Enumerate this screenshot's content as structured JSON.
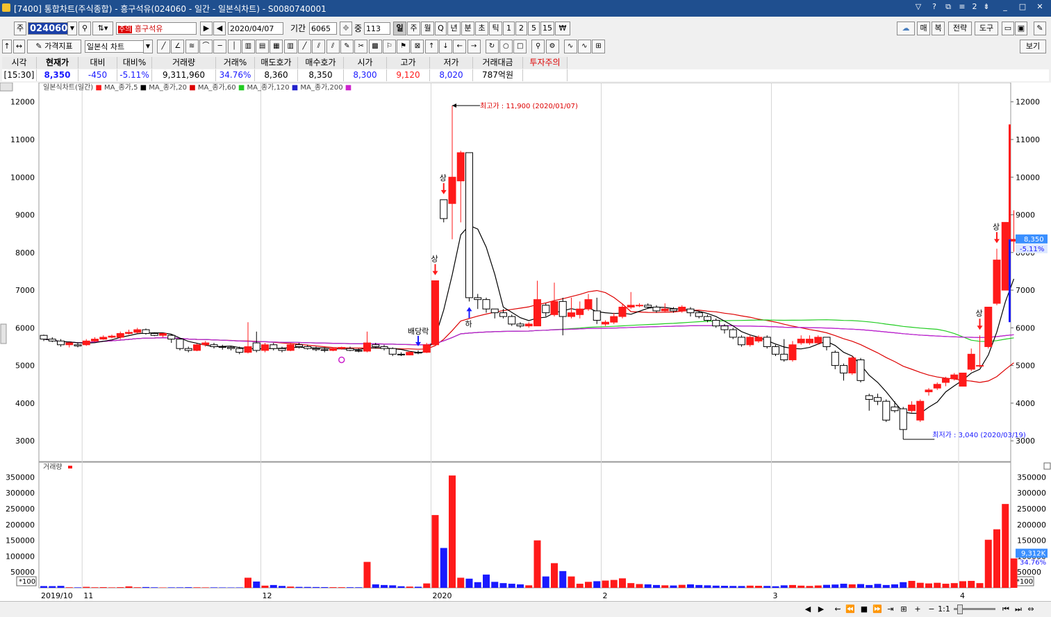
{
  "window": {
    "title": "[7400] 통합차트(주식종합) - 흥구석유(024060 - 일간 - 일본식차트) - S0080740001"
  },
  "toolbar1": {
    "jong_label": "주",
    "code": "024060",
    "warn_badge": "주의",
    "stock_name": "흥구석유",
    "date": "2020/04/07",
    "period_label": "기간",
    "period_value": "6065",
    "count_label": "중",
    "count_value": "113",
    "periods": [
      "일",
      "주",
      "월",
      "Q",
      "년",
      "분",
      "초",
      "틱",
      "1",
      "2",
      "5",
      "15",
      "₩"
    ],
    "right_buttons": [
      "매",
      "복",
      "전략",
      "도구"
    ]
  },
  "toolbar2": {
    "price_indicator": "가격지표",
    "chart_type": "일본식 차트",
    "view_button": "보기"
  },
  "quote": {
    "headers": [
      "시각",
      "현재가",
      "대비",
      "대비%",
      "거래량",
      "거래%",
      "매도호가",
      "매수호가",
      "시가",
      "고가",
      "저가",
      "거래대금",
      "투자주의"
    ],
    "values": [
      "[15:30]",
      "8,350",
      "-450",
      "-5.11%",
      "9,311,960",
      "34.76%",
      "8,360",
      "8,350",
      "8,300",
      "9,120",
      "8,020",
      "787억원",
      ""
    ]
  },
  "colors": {
    "up": "#ff1a1a",
    "down": "#1a1aff",
    "ma5": "#000000",
    "ma20": "#dd0000",
    "ma60": "#22cc22",
    "ma120": "#2222cc",
    "ma200": "#cc22cc"
  },
  "chart_data": {
    "type": "candlestick",
    "title": "일본식차트(일간)",
    "legend": [
      "MA_종가,5",
      "MA_종가,20",
      "MA_종가,60",
      "MA_종가,120",
      "MA_종가,200"
    ],
    "price_axis": {
      "ticks": [
        3000,
        4000,
        5000,
        6000,
        7000,
        8000,
        9000,
        10000,
        11000,
        12000
      ],
      "range": [
        2450,
        12400
      ]
    },
    "x_labels": [
      {
        "label": "2019/10",
        "index": 0
      },
      {
        "label": "11",
        "index": 5
      },
      {
        "label": "12",
        "index": 26
      },
      {
        "label": "2020",
        "index": 46
      },
      {
        "label": "2",
        "index": 66
      },
      {
        "label": "3",
        "index": 86
      },
      {
        "label": "4",
        "index": 108
      }
    ],
    "candles": [
      [
        5800,
        5700,
        5820,
        5650,
        5600
      ],
      [
        5700,
        5650,
        5750,
        5620,
        5400
      ],
      [
        5650,
        5550,
        5700,
        5500,
        6200
      ],
      [
        5550,
        5600,
        5620,
        5480,
        1800
      ],
      [
        5550,
        5520,
        5600,
        5480,
        1500
      ],
      [
        5550,
        5650,
        5700,
        5520,
        3100
      ],
      [
        5650,
        5700,
        5750,
        5620,
        1800
      ],
      [
        5700,
        5750,
        5800,
        5680,
        2200
      ],
      [
        5750,
        5780,
        5820,
        5720,
        1500
      ],
      [
        5750,
        5850,
        5900,
        5700,
        2100
      ],
      [
        5850,
        5880,
        5950,
        5820,
        4600
      ],
      [
        5880,
        5950,
        6000,
        5850,
        1900
      ],
      [
        5950,
        5850,
        5980,
        5820,
        2500
      ],
      [
        5850,
        5800,
        5880,
        5780,
        1700
      ],
      [
        5800,
        5850,
        5860,
        5750,
        1200
      ],
      [
        5800,
        5700,
        5820,
        5600,
        1500
      ],
      [
        5700,
        5450,
        5720,
        5400,
        1600
      ],
      [
        5450,
        5400,
        5500,
        5350,
        2000
      ],
      [
        5400,
        5550,
        5580,
        5380,
        1700
      ],
      [
        5550,
        5600,
        5650,
        5500,
        1400
      ],
      [
        5550,
        5500,
        5600,
        5450,
        1500
      ],
      [
        5500,
        5480,
        5550,
        5420,
        1300
      ],
      [
        5480,
        5450,
        5520,
        5400,
        1200
      ],
      [
        5450,
        5350,
        5500,
        5300,
        1300
      ],
      [
        5350,
        5500,
        6150,
        5320,
        32000
      ],
      [
        5600,
        5400,
        5900,
        5350,
        20000
      ],
      [
        5400,
        5550,
        5600,
        5350,
        7000
      ],
      [
        5550,
        5450,
        5600,
        5400,
        9000
      ],
      [
        5450,
        5400,
        5500,
        5350,
        6000
      ],
      [
        5400,
        5550,
        5600,
        5380,
        4000
      ],
      [
        5550,
        5500,
        5600,
        5450,
        3000
      ],
      [
        5500,
        5450,
        5550,
        5420,
        2800
      ],
      [
        5450,
        5420,
        5500,
        5380,
        2500
      ],
      [
        5420,
        5400,
        5480,
        5350,
        2300
      ],
      [
        5400,
        5450,
        5480,
        5380,
        2100
      ],
      [
        5450,
        5480,
        5500,
        5420,
        2000
      ],
      [
        5450,
        5400,
        5500,
        5380,
        1900
      ],
      [
        5400,
        5380,
        5450,
        5350,
        1800
      ],
      [
        5380,
        5600,
        5900,
        5350,
        82000
      ],
      [
        5550,
        5500,
        5600,
        5450,
        11000
      ],
      [
        5500,
        5450,
        5550,
        5400,
        9000
      ],
      [
        5450,
        5300,
        5480,
        5250,
        8000
      ],
      [
        5300,
        5280,
        5350,
        5250,
        5000
      ],
      [
        5280,
        5350,
        5380,
        5270,
        4000
      ],
      [
        5350,
        5330,
        5400,
        5300,
        3500
      ],
      [
        5350,
        5550,
        5600,
        5330,
        14000
      ],
      [
        5550,
        7250,
        7250,
        5550,
        230000
      ],
      [
        9400,
        8900,
        9400,
        8800,
        126000
      ],
      [
        9300,
        10000,
        11900,
        8350,
        355000
      ],
      [
        9900,
        10650,
        10700,
        8800,
        32000
      ],
      [
        10650,
        6800,
        7200,
        6700,
        29000
      ],
      [
        6800,
        6750,
        6900,
        6500,
        18000
      ],
      [
        6750,
        6500,
        6800,
        6400,
        42000
      ],
      [
        6500,
        6400,
        6500,
        6250,
        19000
      ],
      [
        6400,
        6300,
        6500,
        6250,
        15000
      ],
      [
        6300,
        6100,
        6350,
        6050,
        13000
      ],
      [
        6100,
        6050,
        6150,
        6000,
        11000
      ],
      [
        6050,
        6100,
        6150,
        6000,
        8000
      ],
      [
        6050,
        6750,
        7250,
        6050,
        150000
      ],
      [
        6600,
        6400,
        6650,
        6300,
        36000
      ],
      [
        6350,
        6700,
        7200,
        6300,
        78000
      ],
      [
        6700,
        6300,
        6800,
        5800,
        53000
      ],
      [
        6300,
        6400,
        6800,
        6250,
        36000
      ],
      [
        6350,
        6500,
        6700,
        6250,
        13000
      ],
      [
        6500,
        6750,
        6900,
        6450,
        19000
      ],
      [
        6450,
        6200,
        6800,
        6100,
        21000
      ],
      [
        6100,
        6150,
        6200,
        6050,
        23000
      ],
      [
        6150,
        6300,
        6400,
        6100,
        25000
      ],
      [
        6300,
        6550,
        6650,
        6250,
        30000
      ],
      [
        6550,
        6600,
        6950,
        6500,
        15000
      ],
      [
        6600,
        6600,
        6650,
        6550,
        12000
      ],
      [
        6600,
        6550,
        6650,
        6500,
        11000
      ],
      [
        6550,
        6450,
        6600,
        6400,
        9000
      ],
      [
        6450,
        6500,
        6650,
        6400,
        8000
      ],
      [
        6500,
        6450,
        6550,
        6400,
        7500
      ],
      [
        6450,
        6550,
        6600,
        6400,
        9500
      ],
      [
        6500,
        6400,
        6550,
        6300,
        11000
      ],
      [
        6400,
        6300,
        6450,
        6250,
        9000
      ],
      [
        6300,
        6200,
        6350,
        6150,
        8000
      ],
      [
        6200,
        6050,
        6250,
        6000,
        7000
      ],
      [
        6050,
        5950,
        6100,
        5850,
        6500
      ],
      [
        5950,
        5750,
        6000,
        5700,
        6000
      ],
      [
        5750,
        5550,
        5800,
        5500,
        5800
      ],
      [
        5550,
        5750,
        5800,
        5500,
        7000
      ],
      [
        5650,
        5750,
        5800,
        5600,
        6500
      ],
      [
        5750,
        5500,
        5800,
        5450,
        6000
      ],
      [
        5500,
        5300,
        5550,
        5250,
        5000
      ],
      [
        5300,
        5150,
        5700,
        5100,
        8000
      ],
      [
        5150,
        5550,
        5650,
        5100,
        9000
      ],
      [
        5600,
        5700,
        5800,
        5550,
        7000
      ],
      [
        5600,
        5700,
        5800,
        5550,
        6000
      ],
      [
        5600,
        5750,
        5800,
        5550,
        7500
      ],
      [
        5750,
        5500,
        5750,
        5400,
        9500
      ],
      [
        5350,
        5000,
        5400,
        4900,
        10500
      ],
      [
        5000,
        4800,
        5050,
        4600,
        13000
      ],
      [
        4800,
        5200,
        5250,
        4750,
        11000
      ],
      [
        5150,
        4600,
        5200,
        4550,
        12000
      ],
      [
        4200,
        4100,
        4250,
        3800,
        9000
      ],
      [
        4150,
        4050,
        4250,
        3950,
        12500
      ],
      [
        4050,
        3550,
        4100,
        3500,
        9000
      ],
      [
        3900,
        3800,
        4050,
        3750,
        11000
      ],
      [
        3850,
        3300,
        3900,
        3040,
        18000
      ],
      [
        3800,
        3950,
        4050,
        3750,
        22000
      ],
      [
        3550,
        4050,
        4100,
        3500,
        16000
      ],
      [
        4300,
        4350,
        4400,
        4200,
        14000
      ],
      [
        4400,
        4500,
        4550,
        4350,
        16000
      ],
      [
        4550,
        4650,
        4700,
        4450,
        13000
      ],
      [
        4650,
        4750,
        4800,
        4600,
        15000
      ],
      [
        4450,
        4800,
        4800,
        4450,
        21000
      ],
      [
        4900,
        5300,
        5450,
        4850,
        22000
      ],
      [
        5000,
        5000,
        5800,
        4950,
        15000
      ],
      [
        5500,
        6550,
        6550,
        5450,
        152000
      ],
      [
        6650,
        7800,
        8100,
        6600,
        185000
      ],
      [
        7000,
        8800,
        8800,
        7000,
        265000
      ],
      [
        8300,
        8350,
        9120,
        8020,
        93000
      ]
    ],
    "annotations": [
      {
        "text": "최고가 : 11,900 (2020/01/07)",
        "index": 48
      },
      {
        "text": "최저가 : 3,040 (2020/03/19)",
        "index": 101
      },
      {
        "text": "배당락",
        "index": 44
      },
      {
        "text": "상",
        "index": 46
      },
      {
        "text": "상",
        "index": 47
      },
      {
        "text": "하",
        "index": 50
      },
      {
        "text": "상",
        "index": 110
      },
      {
        "text": "상",
        "index": 112
      }
    ],
    "last_price": {
      "value": "8,350",
      "change": "-5.11%"
    },
    "volume": {
      "title": "거래량",
      "ticks": [
        50000,
        100000,
        150000,
        200000,
        250000,
        300000,
        350000
      ],
      "range": [
        0,
        375000
      ],
      "unit": "*100",
      "last": "9,312K",
      "last_pct": "34.76%"
    }
  },
  "statusbar": {
    "zoom": "1:1"
  }
}
